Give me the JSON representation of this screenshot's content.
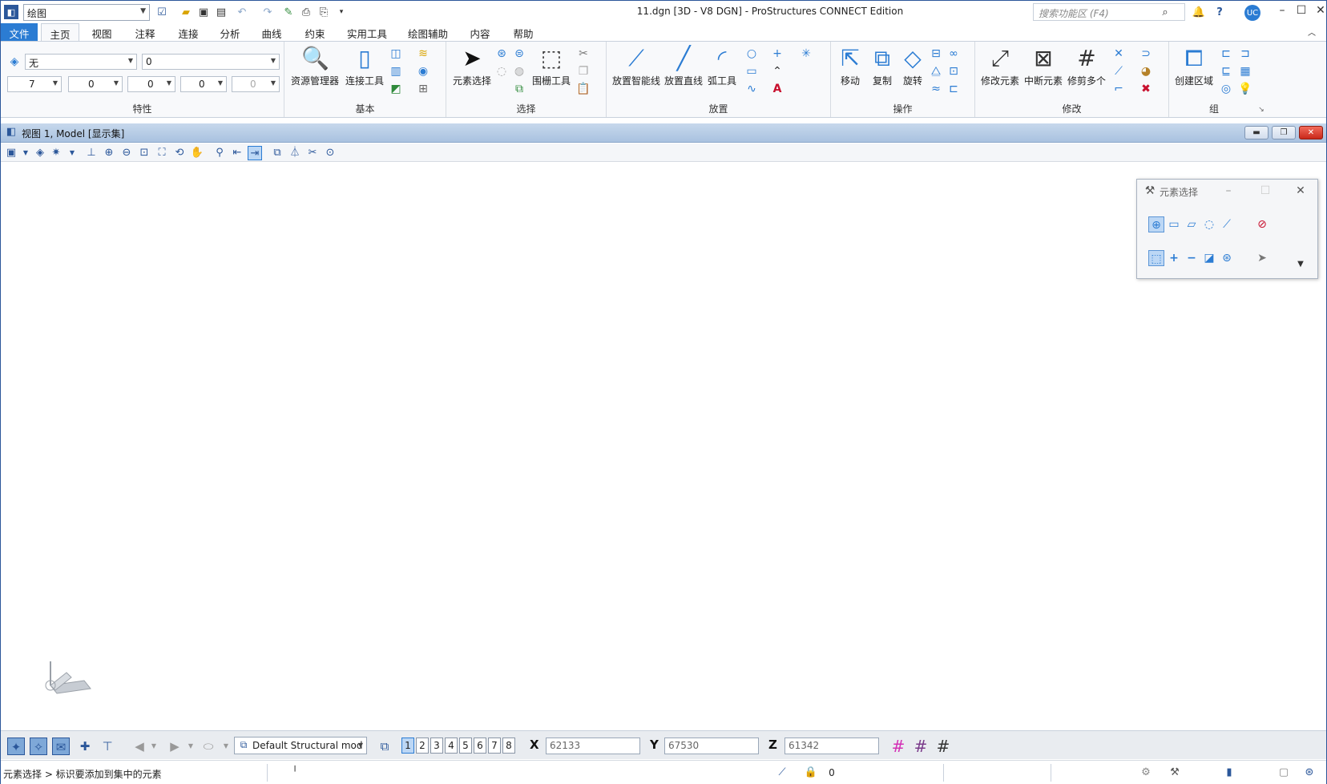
{
  "titlebar": {
    "workspace": "绘图",
    "title": "11.dgn [3D - V8 DGN] - ProStructures CONNECT Edition",
    "search_placeholder": "搜索功能区 (F4)",
    "user_initials": "UC"
  },
  "tabs": [
    "文件",
    "主页",
    "视图",
    "注释",
    "连接",
    "分析",
    "曲线",
    "约束",
    "实用工具",
    "绘图辅助",
    "内容",
    "帮助"
  ],
  "ribbon": {
    "attributes": {
      "level": "无",
      "style_value": "0",
      "color": "7",
      "weight": "0",
      "linestyle": "0",
      "transparency": "0",
      "priority": "0",
      "label": "特性"
    },
    "primary": {
      "explorer": "资源管理器",
      "attach_tools": "连接工具",
      "label": "基本"
    },
    "selection": {
      "element_selection": "元素选择",
      "fence_tool": "围栅工具",
      "label": "选择"
    },
    "placement": {
      "smartline": "放置智能线",
      "line": "放置直线",
      "arc": "弧工具",
      "label": "放置"
    },
    "manipulate": {
      "move": "移动",
      "copy": "复制",
      "rotate": "旋转",
      "label": "操作"
    },
    "modify": {
      "modify_element": "修改元素",
      "break_element": "中断元素",
      "trim_multiple": "修剪多个",
      "label": "修改"
    },
    "groups": {
      "create_region": "创建区域",
      "label": "组"
    }
  },
  "view": {
    "title": "视图 1, Model [显示集]"
  },
  "selection_panel": {
    "title": "元素选择"
  },
  "bottombar": {
    "model": "Default Structural mod",
    "view_numbers": [
      "1",
      "2",
      "3",
      "4",
      "5",
      "6",
      "7",
      "8"
    ],
    "x_label": "X",
    "x_value": "62133",
    "y_label": "Y",
    "y_value": "67530",
    "z_label": "Z",
    "z_value": "61342"
  },
  "statusbar": {
    "message": "元素选择 > 标识要添加到集中的元素",
    "lock_count": "0"
  },
  "colors": {
    "accent": "#2b7cd3",
    "view_header": "#b8cde6",
    "grid_active": "#d42fb5"
  }
}
